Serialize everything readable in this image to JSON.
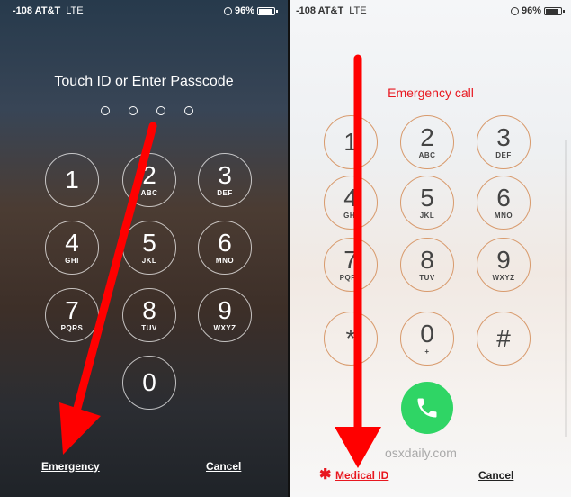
{
  "left": {
    "carrier": "-108 AT&T",
    "network": "LTE",
    "battery": "96%",
    "title": "Touch ID or Enter Passcode",
    "keys": [
      {
        "num": "1",
        "letters": ""
      },
      {
        "num": "2",
        "letters": "ABC"
      },
      {
        "num": "3",
        "letters": "DEF"
      },
      {
        "num": "4",
        "letters": "GHI"
      },
      {
        "num": "5",
        "letters": "JKL"
      },
      {
        "num": "6",
        "letters": "MNO"
      },
      {
        "num": "7",
        "letters": "PQRS"
      },
      {
        "num": "8",
        "letters": "TUV"
      },
      {
        "num": "9",
        "letters": "WXYZ"
      },
      {
        "num": "0",
        "letters": ""
      }
    ],
    "emergency": "Emergency",
    "cancel": "Cancel"
  },
  "right": {
    "carrier": "-108 AT&T",
    "network": "LTE",
    "battery": "96%",
    "title": "Emergency call",
    "keys": [
      {
        "num": "1",
        "letters": ""
      },
      {
        "num": "2",
        "letters": "ABC"
      },
      {
        "num": "3",
        "letters": "DEF"
      },
      {
        "num": "4",
        "letters": "GHI"
      },
      {
        "num": "5",
        "letters": "JKL"
      },
      {
        "num": "6",
        "letters": "MNO"
      },
      {
        "num": "7",
        "letters": "PQRS"
      },
      {
        "num": "8",
        "letters": "TUV"
      },
      {
        "num": "9",
        "letters": "WXYZ"
      },
      {
        "num": "*",
        "letters": ""
      },
      {
        "num": "0",
        "letters": "+"
      },
      {
        "num": "#",
        "letters": ""
      }
    ],
    "watermark": "osxdaily.com",
    "medical_asterisk": "✱",
    "medical_id": "Medical ID",
    "cancel": "Cancel"
  },
  "colors": {
    "arrow": "#ff0000",
    "emergency_red": "#e8171f",
    "call_green": "#2fd565",
    "key_ring_right": "#d89a6c"
  },
  "icons": [
    "orientation-lock-icon",
    "battery-icon",
    "phone-icon"
  ]
}
